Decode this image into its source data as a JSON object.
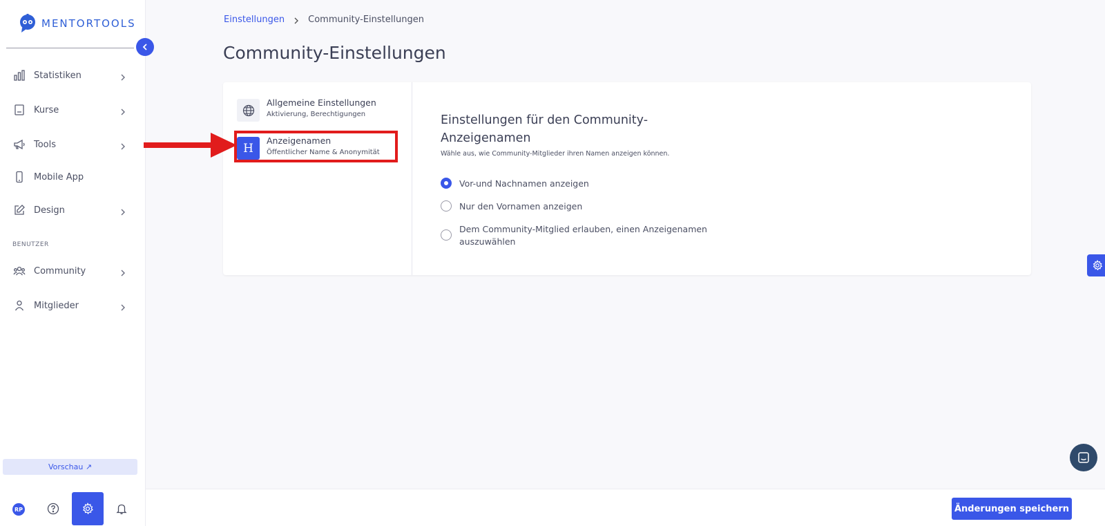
{
  "brand": {
    "name": "MENTORTOOLS",
    "color": "#2f5fd6"
  },
  "sidebar": {
    "items": [
      {
        "label": "Statistiken",
        "icon": "bar-chart-icon",
        "has_chevron": true
      },
      {
        "label": "Kurse",
        "icon": "book-icon",
        "has_chevron": true
      },
      {
        "label": "Tools",
        "icon": "megaphone-icon",
        "has_chevron": true
      },
      {
        "label": "Mobile App",
        "icon": "mobile-icon",
        "has_chevron": false
      },
      {
        "label": "Design",
        "icon": "edit-icon",
        "has_chevron": true
      }
    ],
    "section_label": "BENUTZER",
    "user_items": [
      {
        "label": "Community",
        "icon": "users-icon",
        "has_chevron": true
      },
      {
        "label": "Mitglieder",
        "icon": "user-icon",
        "has_chevron": true
      }
    ],
    "preview_label": "Vorschau ↗",
    "avatar_initials": "RP"
  },
  "breadcrumb": {
    "parent": "Einstellungen",
    "current": "Community-Einstellungen"
  },
  "page_title": "Community-Einstellungen",
  "settings_menu": [
    {
      "title": "Allgemeine Einstellungen",
      "subtitle": "Aktivierung, Berechtigungen",
      "icon": "globe-icon",
      "active": false
    },
    {
      "title": "Anzeigenamen",
      "subtitle": "Öffentlicher Name & Anonymität",
      "icon_glyph": "H",
      "active": true
    }
  ],
  "panel": {
    "title": "Einstellungen für den Community-Anzeigenamen",
    "description": "Wähle aus, wie Community-Mitglieder ihren Namen anzeigen können.",
    "options": [
      {
        "label": "Vor-und Nachnamen anzeigen",
        "checked": true
      },
      {
        "label": "Nur den Vornamen anzeigen",
        "checked": false
      },
      {
        "label": "Dem Community-Mitglied erlauben, einen Anzeigenamen auszuwählen",
        "checked": false
      }
    ]
  },
  "footer": {
    "save_label": "Änderungen speichern"
  },
  "colors": {
    "accent": "#3a57e8",
    "annotation": "#e11c1c"
  }
}
